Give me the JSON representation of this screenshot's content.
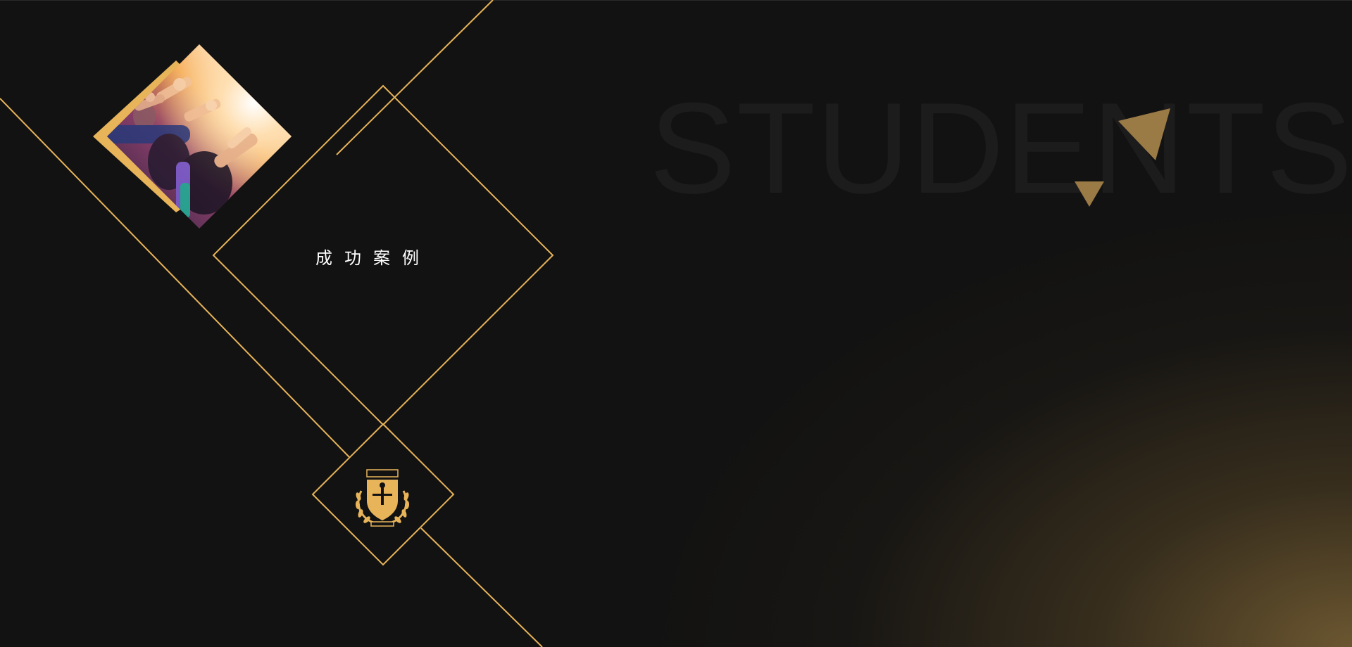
{
  "slide": {
    "background_word": "STUDENTS",
    "title": "成功案例",
    "photo": {
      "description_icon": "crowd-thumbs-up-photo"
    },
    "emblem": {
      "icon": "university-crest-icon"
    },
    "colors": {
      "background": "#121212",
      "accent_gold": "#E8B45A",
      "triangle_gold": "#9A7A45",
      "background_word": "#1C1C1C",
      "title_text": "#FFFFFF"
    }
  }
}
